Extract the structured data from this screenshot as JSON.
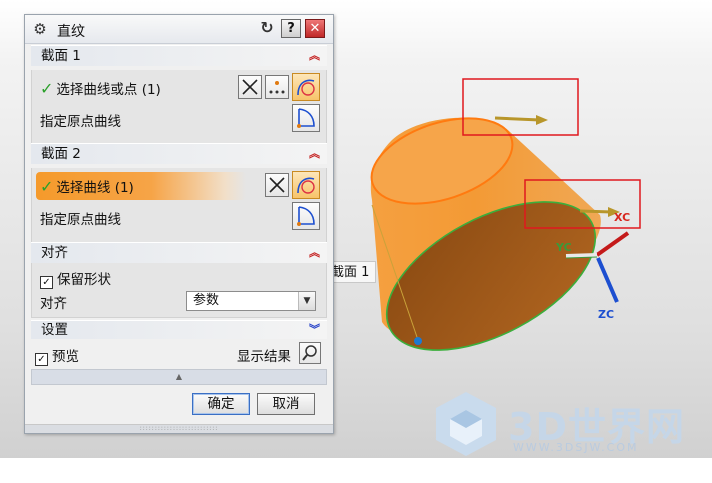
{
  "dialog": {
    "title": "直纹",
    "help_label": "?",
    "close_label": "✕",
    "section1": {
      "header": "截面 1",
      "select_row_label": "选择曲线或点 (1)",
      "origin_label": "指定原点曲线"
    },
    "section2": {
      "header": "截面 2",
      "select_row_label": "选择曲线 (1)",
      "origin_label": "指定原点曲线"
    },
    "align": {
      "header": "对齐",
      "keep_shape_label": "保留形状",
      "keep_shape_checked": true,
      "align_label": "对齐",
      "align_value": "参数"
    },
    "settings": {
      "header": "设置",
      "preview_label": "预览",
      "preview_checked": true,
      "show_result_label": "显示结果"
    },
    "ok_label": "确定",
    "cancel_label": "取消"
  },
  "viewport": {
    "tooltip": "截面 1",
    "axis_labels": {
      "x": "XC",
      "y": "YC",
      "z": "ZC"
    },
    "shape_color": "#f59a32",
    "highlight_box_color": "#e0181e"
  },
  "watermark": {
    "text": "3D世界网",
    "subtext": "WWW.3DSJW.COM"
  },
  "icons": [
    "gear-icon",
    "reset-icon",
    "help-icon",
    "close-icon",
    "collapse-icon",
    "expand-icon",
    "point-dialog-icon",
    "point-icon",
    "curve-rule-icon",
    "origin-curve-icon",
    "dropdown-arrow-icon",
    "magnifier-icon"
  ]
}
